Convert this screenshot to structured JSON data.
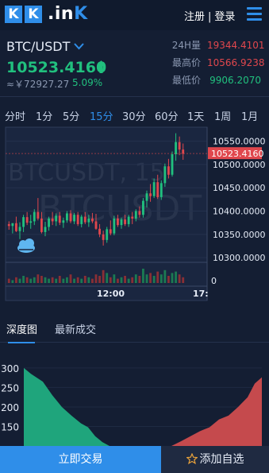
{
  "header": {
    "logo_letters": [
      "K",
      "K"
    ],
    "logo_word_prefix": ".in",
    "logo_word_suffix": "K",
    "register_label": "注册",
    "divider": "|",
    "login_label": "登录"
  },
  "ticker": {
    "pair": "BTC/USDT",
    "last_price": "10523.4160",
    "cny_value": "≈￥72927.27",
    "change_pct": "5.09%",
    "stats": [
      {
        "label": "24H量",
        "value": "19344.4101",
        "color": "#e0474d"
      },
      {
        "label": "最高价",
        "value": "10566.9238",
        "color": "#e0474d"
      },
      {
        "label": "最低价",
        "value": "9906.2070",
        "color": "#21c07e"
      }
    ]
  },
  "timeframes": {
    "items": [
      "分时",
      "1分",
      "5分",
      "15分",
      "30分",
      "60分",
      "1天",
      "1周",
      "1月"
    ],
    "active": "15分"
  },
  "chart_data": {
    "type": "candlestick",
    "watermark_line1": "BTCUSDT, 15",
    "watermark_line2": "BTCUSDT",
    "y_ticks": [
      "10550.0000",
      "10500.0000",
      "10450.0000",
      "10400.0000",
      "10350.0000",
      "10300.0000"
    ],
    "y_range": [
      10290,
      10580
    ],
    "current_price_label": "10523.4160",
    "current_price": 10523.416,
    "volume_tick": "0",
    "x_ticks": [
      "12:00",
      "17:"
    ],
    "candles": [
      [
        10372,
        10378,
        10360,
        10368
      ],
      [
        10368,
        10374,
        10352,
        10374
      ],
      [
        10374,
        10388,
        10355,
        10357
      ],
      [
        10357,
        10376,
        10340,
        10366
      ],
      [
        10366,
        10392,
        10355,
        10387
      ],
      [
        10387,
        10398,
        10370,
        10375
      ],
      [
        10375,
        10392,
        10362,
        10378
      ],
      [
        10378,
        10404,
        10370,
        10398
      ],
      [
        10398,
        10428,
        10380,
        10384
      ],
      [
        10384,
        10398,
        10352,
        10355
      ],
      [
        10355,
        10377,
        10346,
        10366
      ],
      [
        10366,
        10388,
        10358,
        10384
      ],
      [
        10384,
        10398,
        10370,
        10378
      ],
      [
        10378,
        10395,
        10368,
        10390
      ],
      [
        10390,
        10398,
        10370,
        10375
      ],
      [
        10375,
        10386,
        10364,
        10380
      ],
      [
        10380,
        10400,
        10375,
        10395
      ],
      [
        10395,
        10402,
        10374,
        10378
      ],
      [
        10378,
        10396,
        10372,
        10392
      ],
      [
        10392,
        10398,
        10368,
        10372
      ],
      [
        10372,
        10392,
        10365,
        10388
      ],
      [
        10388,
        10398,
        10372,
        10376
      ],
      [
        10376,
        10392,
        10366,
        10384
      ],
      [
        10384,
        10396,
        10374,
        10378
      ],
      [
        10378,
        10394,
        10360,
        10362
      ],
      [
        10362,
        10372,
        10344,
        10350
      ],
      [
        10350,
        10358,
        10326,
        10338
      ],
      [
        10338,
        10366,
        10332,
        10361
      ],
      [
        10361,
        10380,
        10348,
        10352
      ],
      [
        10352,
        10390,
        10348,
        10384
      ],
      [
        10384,
        10392,
        10366,
        10370
      ],
      [
        10370,
        10386,
        10362,
        10382
      ],
      [
        10382,
        10392,
        10368,
        10372
      ],
      [
        10372,
        10392,
        10366,
        10388
      ],
      [
        10388,
        10398,
        10372,
        10384
      ],
      [
        10384,
        10404,
        10378,
        10400
      ],
      [
        10400,
        10410,
        10386,
        10392
      ],
      [
        10392,
        10428,
        10386,
        10422
      ],
      [
        10422,
        10444,
        10408,
        10438
      ],
      [
        10438,
        10458,
        10420,
        10432
      ],
      [
        10432,
        10470,
        10428,
        10462
      ],
      [
        10462,
        10478,
        10426,
        10430
      ],
      [
        10430,
        10466,
        10424,
        10460
      ],
      [
        10460,
        10502,
        10452,
        10496
      ],
      [
        10496,
        10512,
        10470,
        10478
      ],
      [
        10478,
        10528,
        10474,
        10522
      ],
      [
        10522,
        10567,
        10508,
        10548
      ],
      [
        10548,
        10560,
        10520,
        10532
      ],
      [
        10532,
        10545,
        10510,
        10523
      ]
    ],
    "volumes": [
      3,
      2,
      4,
      3,
      5,
      4,
      3,
      4,
      6,
      5,
      4,
      3,
      4,
      3,
      5,
      3,
      4,
      6,
      3,
      4,
      3,
      5,
      4,
      3,
      6,
      5,
      9,
      7,
      4,
      6,
      3,
      4,
      5,
      3,
      4,
      6,
      5,
      10,
      6,
      7,
      5,
      8,
      6,
      9,
      5,
      7,
      8,
      6,
      4
    ]
  },
  "tabs": {
    "items": [
      "深度图",
      "最新成交"
    ],
    "active": "深度图"
  },
  "depth_chart": {
    "y_ticks": [
      "300",
      "250",
      "200",
      "150"
    ],
    "y_range": [
      100,
      310
    ],
    "bids": [
      [
        0,
        300
      ],
      [
        0.03,
        285
      ],
      [
        0.08,
        265
      ],
      [
        0.12,
        230
      ],
      [
        0.16,
        200
      ],
      [
        0.2,
        178
      ],
      [
        0.24,
        158
      ],
      [
        0.27,
        148
      ],
      [
        0.3,
        125
      ],
      [
        0.33,
        110
      ],
      [
        0.36,
        100
      ]
    ],
    "asks": [
      [
        0.62,
        100
      ],
      [
        0.66,
        112
      ],
      [
        0.7,
        125
      ],
      [
        0.74,
        138
      ],
      [
        0.78,
        148
      ],
      [
        0.82,
        168
      ],
      [
        0.86,
        178
      ],
      [
        0.9,
        200
      ],
      [
        0.94,
        225
      ],
      [
        0.97,
        260
      ],
      [
        1.0,
        276
      ]
    ],
    "bid_color": "#1fa57c",
    "ask_color": "#c54a4d"
  },
  "actions": {
    "trade_label": "立即交易",
    "favorite_label": "添加自选"
  },
  "colors": {
    "up": "#21c07e",
    "down": "#e0474d",
    "accent": "#2f8ee9",
    "background": "#141e33"
  }
}
